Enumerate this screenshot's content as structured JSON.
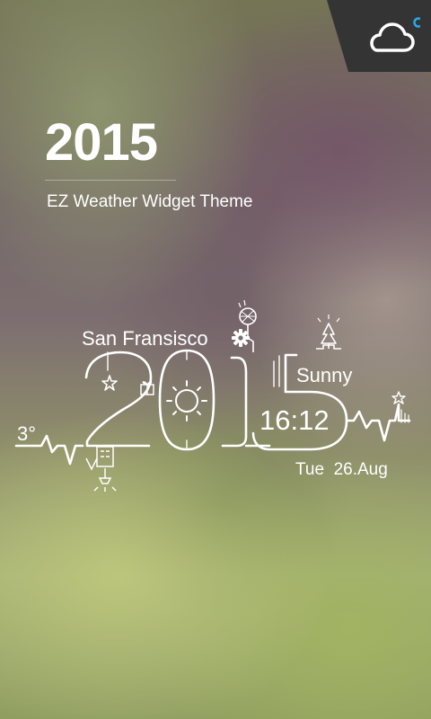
{
  "status": {
    "icon": "cloud-icon",
    "indicator_color": "#29a8e8",
    "background": "#343434"
  },
  "promo": {
    "headline": "2015",
    "subtitle": "EZ Weather Widget Theme"
  },
  "widget": {
    "city": "San Fransisco",
    "condition": "Sunny",
    "temperature": "3°",
    "time": "16:12",
    "date": "Tue  26.Aug",
    "big_year": "2015",
    "icons": {
      "settings": "gear-icon",
      "weather": "sun-icon",
      "location": "tree-icon"
    }
  }
}
